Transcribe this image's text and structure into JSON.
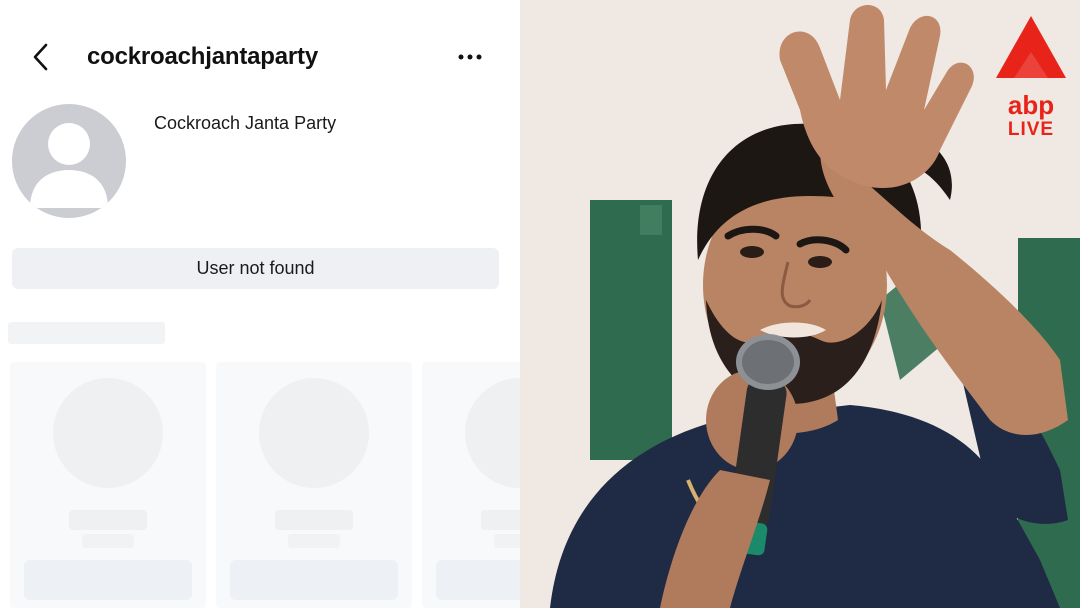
{
  "profile": {
    "username": "cockroachjantaparty",
    "display_name": "Cockroach Janta Party",
    "status_message": "User not found",
    "back_icon": "chevron-left-icon",
    "more_icon": "more-horizontal-icon",
    "avatar_icon": "default-avatar-icon"
  },
  "logo": {
    "word": "abp",
    "sub": "LIVE",
    "color": "#e8231a"
  }
}
